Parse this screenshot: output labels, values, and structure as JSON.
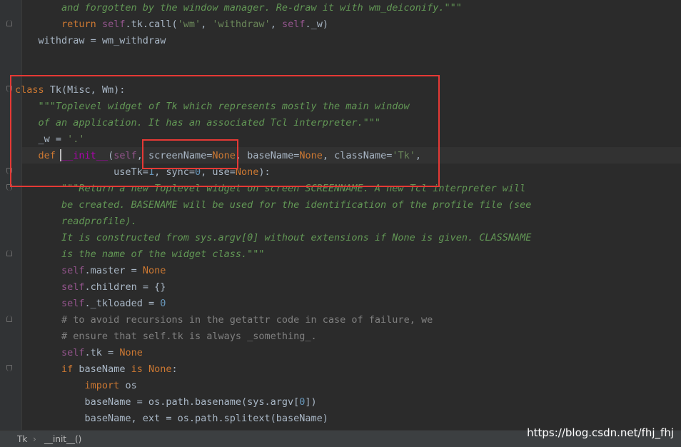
{
  "lines": [
    "        and forgotten by the window manager. Re-draw it with wm_deiconify.\"\"\"",
    "        return self.tk.call('wm', 'withdraw', self._w)",
    "    withdraw = wm_withdraw",
    "",
    "",
    "class Tk(Misc, Wm):",
    "    \"\"\"Toplevel widget of Tk which represents mostly the main window",
    "    of an application. It has an associated Tcl interpreter.\"\"\"",
    "    _w = '.'",
    "    def __init__(self, screenName=None, baseName=None, className='Tk',",
    "                 useTk=1, sync=0, use=None):",
    "        \"\"\"Return a new Toplevel widget on screen SCREENNAME. A new Tcl interpreter will",
    "        be created. BASENAME will be used for the identification of the profile file (see",
    "        readprofile).",
    "        It is constructed from sys.argv[0] without extensions if None is given. CLASSNAME",
    "        is the name of the widget class.\"\"\"",
    "        self.master = None",
    "        self.children = {}",
    "        self._tkloaded = 0",
    "        # to avoid recursions in the getattr code in case of failure, we",
    "        # ensure that self.tk is always _something_.",
    "        self.tk = None",
    "        if baseName is None:",
    "            import os",
    "            baseName = os.path.basename(sys.argv[0])",
    "            baseName, ext = os.path.splitext(baseName)"
  ],
  "breadcrumb": {
    "class_name": "Tk",
    "separator": "›",
    "method_name": "__init__()"
  },
  "watermark": "https://blog.csdn.net/fhj_fhj",
  "colors": {
    "background": "#2b2b2b",
    "keyword": "#cc7832",
    "self": "#94558d",
    "string": "#6a8759",
    "docstring": "#629755",
    "number": "#6897bb",
    "comment": "#808080",
    "annotation_box": "#e53935"
  }
}
